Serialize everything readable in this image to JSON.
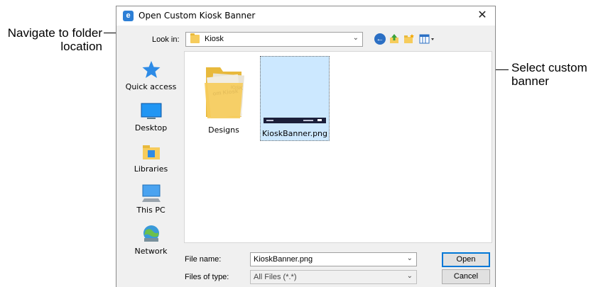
{
  "annotations": {
    "left": "Navigate to folder location",
    "right": "Select custom banner"
  },
  "dialog": {
    "title": "Open Custom Kiosk Banner",
    "close_glyph": "✕",
    "look_in_label": "Look in:",
    "look_in_value": "Kiosk",
    "toolbar_icons": [
      "back-icon",
      "up-folder-icon",
      "new-folder-icon",
      "view-menu-icon"
    ]
  },
  "places": [
    {
      "label": "Quick access",
      "icon": "quick-access-star-icon"
    },
    {
      "label": "Desktop",
      "icon": "desktop-icon"
    },
    {
      "label": "Libraries",
      "icon": "libraries-icon"
    },
    {
      "label": "This PC",
      "icon": "this-pc-icon"
    },
    {
      "label": "Network",
      "icon": "network-icon"
    }
  ],
  "files": [
    {
      "name": "Designs",
      "type": "folder",
      "selected": false
    },
    {
      "name": "KioskBanner.png",
      "type": "image",
      "selected": true
    }
  ],
  "file_name": {
    "label": "File name:",
    "value": "KioskBanner.png"
  },
  "file_type": {
    "label": "Files of type:",
    "value": "All Files (*.*)"
  },
  "buttons": {
    "open": "Open",
    "cancel": "Cancel"
  },
  "colors": {
    "selection": "#cce8ff",
    "accent": "#0078d7",
    "folder": "#f6cc5c"
  }
}
